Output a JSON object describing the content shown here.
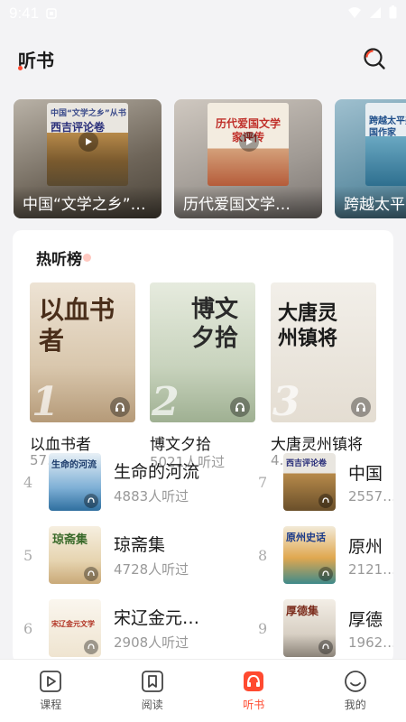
{
  "status_bar": {
    "time": "9:41"
  },
  "header": {
    "title": "听书"
  },
  "banners": [
    {
      "caption": "中国“文学之乡”…",
      "cover_text": "西吉评论卷",
      "cover_sub": "中国“文学之乡”从书"
    },
    {
      "caption": "历代爱国文学…",
      "cover_text": "历代爱国文学家评传"
    },
    {
      "caption": "跨越太平…",
      "cover_text": "跨越太平美国作家"
    }
  ],
  "hot_list": {
    "title": "热听榜",
    "top": [
      {
        "rank": "1",
        "name": "以血书者",
        "count": "57…",
        "cover_text": "以血书者"
      },
      {
        "rank": "2",
        "name": "博文夕拾",
        "count": "5021人听过",
        "cover_text": "博文夕拾"
      },
      {
        "rank": "3",
        "name": "大唐灵州镇将",
        "count": "4…",
        "cover_text": "大唐灵州镇将"
      }
    ],
    "left_rows": [
      {
        "rank": "4",
        "name": "生命的河流",
        "count": "4883人听过",
        "cover_text": "生命的河流"
      },
      {
        "rank": "5",
        "name": "琼斋集",
        "count": "4728人听过",
        "cover_text": "琼斋集"
      },
      {
        "rank": "6",
        "name": "宋辽金元…",
        "count": "2908人听过",
        "cover_text": "宋辽金元文学"
      }
    ],
    "right_rows": [
      {
        "rank": "7",
        "name": "中国",
        "count": "2557…",
        "cover_text": "西吉评论卷"
      },
      {
        "rank": "8",
        "name": "原州",
        "count": "2121…",
        "cover_text": "原州史话"
      },
      {
        "rank": "9",
        "name": "厚德",
        "count": "1962…",
        "cover_text": "厚德集"
      }
    ]
  },
  "tabs": [
    {
      "label": "课程",
      "icon": "play-square-icon",
      "active": false
    },
    {
      "label": "阅读",
      "icon": "bookmark-icon",
      "active": false
    },
    {
      "label": "听书",
      "icon": "headphones-icon",
      "active": true
    },
    {
      "label": "我的",
      "icon": "smile-icon",
      "active": false
    }
  ],
  "colors": {
    "accent": "#ff4a30",
    "background": "#f3f3f5"
  }
}
